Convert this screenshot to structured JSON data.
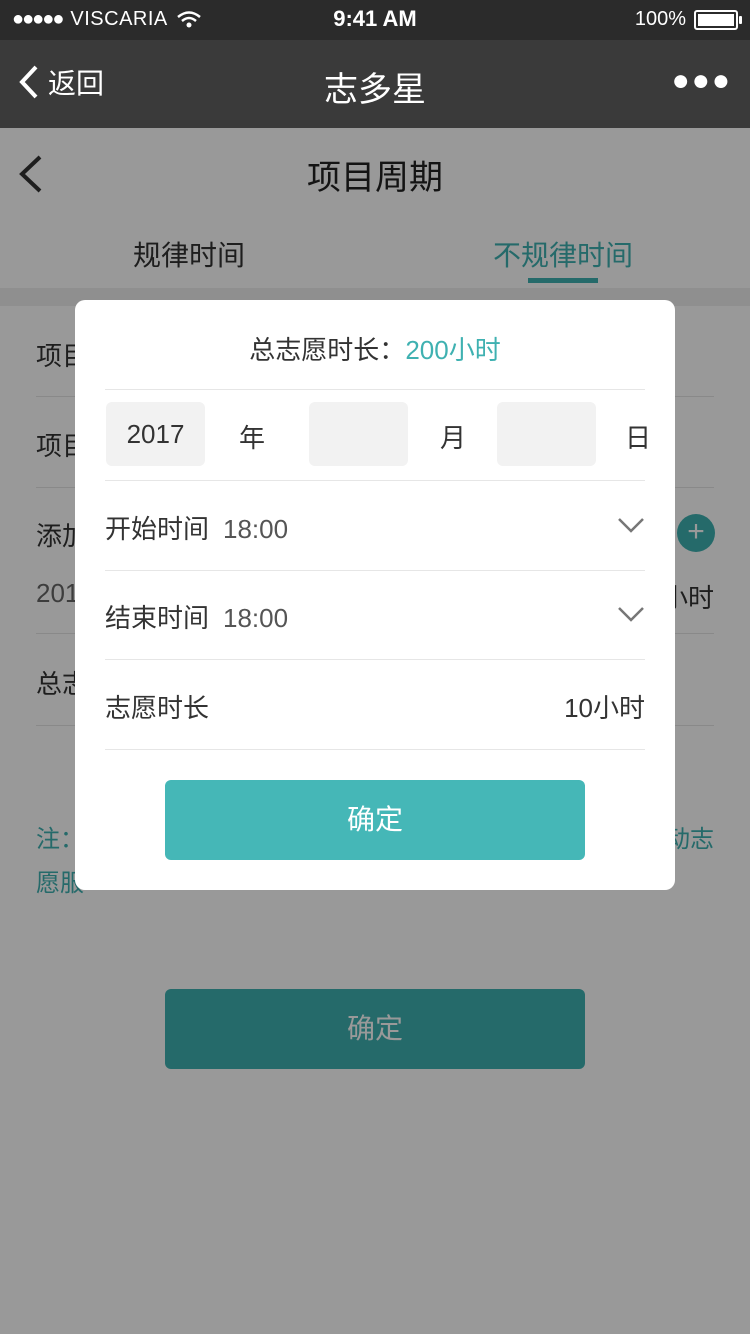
{
  "status_bar": {
    "signal": "●●●●●",
    "carrier": "VISCARIA",
    "time": "9:41 AM",
    "battery": "100%"
  },
  "nav": {
    "back_label": "返回",
    "title": "志多星"
  },
  "page": {
    "title": "项目周期",
    "tabs": [
      "规律时间",
      "不规律时间"
    ],
    "selected_tab": "不规律时间",
    "form_rows": [
      "项目",
      "项目",
      "添加",
      "201",
      "总志"
    ],
    "row_right": "小时",
    "note_line1": "注：",
    "note_line1_right": "动志",
    "note_line2": "愿服",
    "confirm_label": "确定"
  },
  "modal": {
    "total_label": "总志愿时长：",
    "total_value": "200小时",
    "year_value": "2017",
    "year_label": "年",
    "month_value": "",
    "month_label": "月",
    "day_value": "",
    "day_label": "日",
    "start_label": "开始时间",
    "start_time": "18:00",
    "end_label": "结束时间",
    "end_time": "18:00",
    "duration_label": "志愿时长",
    "duration_value": "10小时",
    "confirm_label": "确定"
  },
  "colors": {
    "accent": "#3fb1b1",
    "nav_bg": "#3a3a3a",
    "overlay": "rgba(0,0,0,0.40)"
  }
}
